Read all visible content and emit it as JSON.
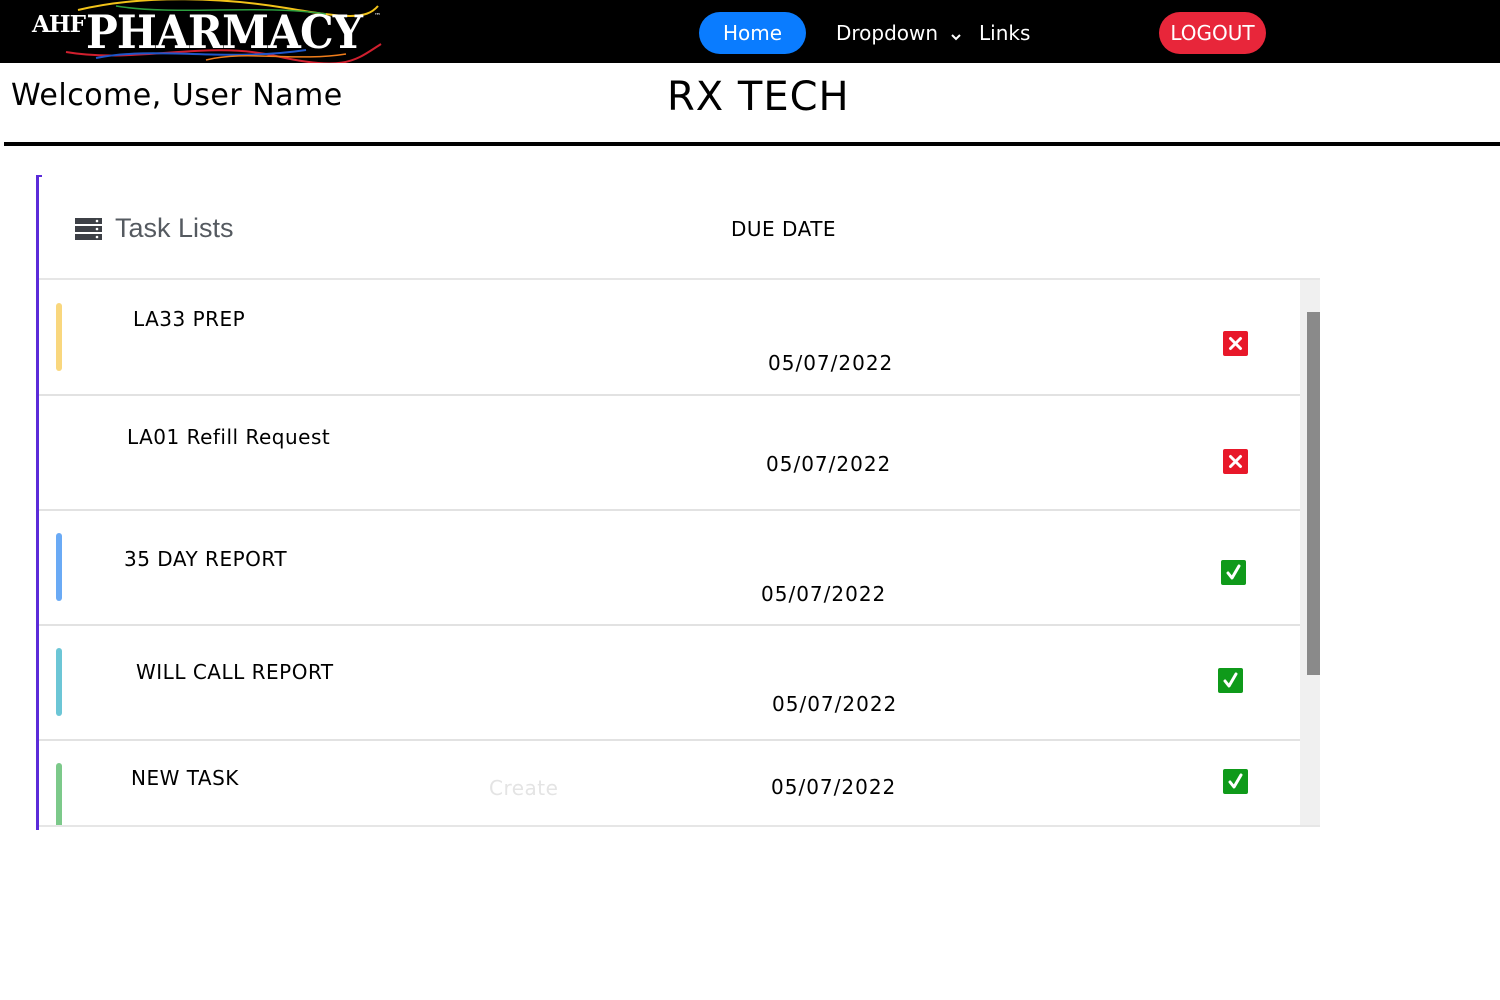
{
  "brand": {
    "prefix": "AHF",
    "name": "PHARMACY",
    "trademark": "™",
    "swirl_colors": [
      "#f2c319",
      "#d11f2e",
      "#1f56c9",
      "#2c9e3e",
      "#f07d1a"
    ]
  },
  "nav": {
    "home_label": "Home",
    "dropdown_label": "Dropdown",
    "links_label": "Links",
    "logout_label": "LOGOUT",
    "home_color": "#0a7cff",
    "logout_color": "#e8263a"
  },
  "header": {
    "welcome": "Welcome, User Name",
    "title": "RX TECH"
  },
  "tasks": {
    "heading": "Task Lists",
    "due_date_header": "DUE DATE",
    "create_placeholder": "Create",
    "rows": [
      {
        "name": "LA33 PREP",
        "due": "05/07/2022",
        "status": "incomplete",
        "accent": "#f9d77e"
      },
      {
        "name": "LA01 Refill Request",
        "due": "05/07/2022",
        "status": "incomplete",
        "accent": ""
      },
      {
        "name": "35 DAY REPORT",
        "due": "05/07/2022",
        "status": "complete",
        "accent": "#6aaaf5"
      },
      {
        "name": "WILL CALL REPORT",
        "due": "05/07/2022",
        "status": "complete",
        "accent": "#6cc6d6"
      },
      {
        "name": "NEW TASK",
        "due": "05/07/2022",
        "status": "complete",
        "accent": "#7cc98a"
      }
    ]
  },
  "icons": {
    "incomplete": "x-mark-icon",
    "complete": "checkmark-icon",
    "task_list": "server-list-icon",
    "dropdown": "chevron-down-icon"
  }
}
